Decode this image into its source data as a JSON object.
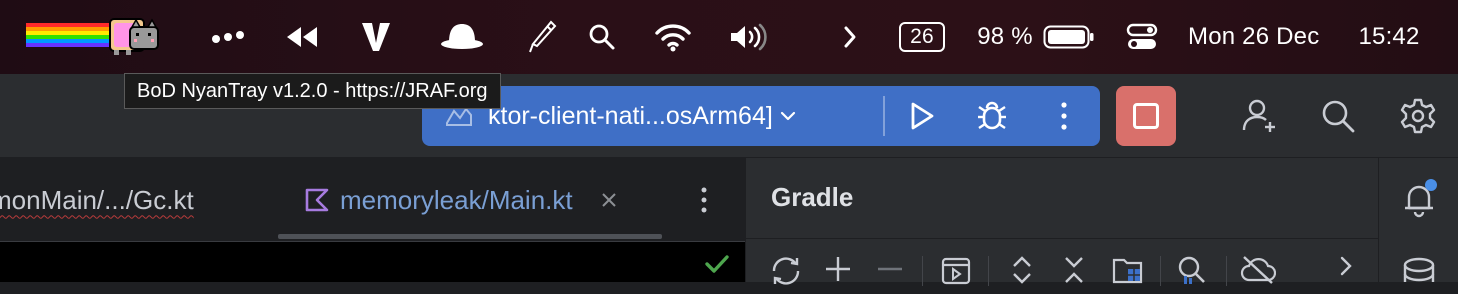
{
  "menubar": {
    "date": "Mon 26 Dec",
    "time": "15:42",
    "battery_pct": "98 %",
    "badge_number": "26",
    "icons": [
      "nyan-cat-icon",
      "more-dots-icon",
      "rewind-icon",
      "v-logo-icon",
      "bowler-hat-icon",
      "pen-tool-icon",
      "search-icon",
      "wifi-icon",
      "volume-icon",
      "chevron-right-icon",
      "battery-icon",
      "control-center-icon"
    ]
  },
  "tooltip": {
    "text": "BoD NyanTray v1.2.0 - https://JRAF.org"
  },
  "toolbar": {
    "run_config_label": "ktor-client-nati...osArm64]",
    "buttons": [
      "run-icon",
      "debug-icon",
      "more-vertical-icon",
      "stop-icon",
      "add-user-icon",
      "search-icon",
      "settings-icon"
    ]
  },
  "editor": {
    "tabs": [
      {
        "label": "monMain/.../Gc.kt",
        "active": false
      },
      {
        "label": "memoryleak/Main.kt",
        "active": true
      }
    ]
  },
  "gradle": {
    "title": "Gradle"
  },
  "colors": {
    "run_widget": "#3f6fc6",
    "stop_button": "#d9706b",
    "notification_dot": "#4a8fe7",
    "check": "#4ea64e"
  }
}
